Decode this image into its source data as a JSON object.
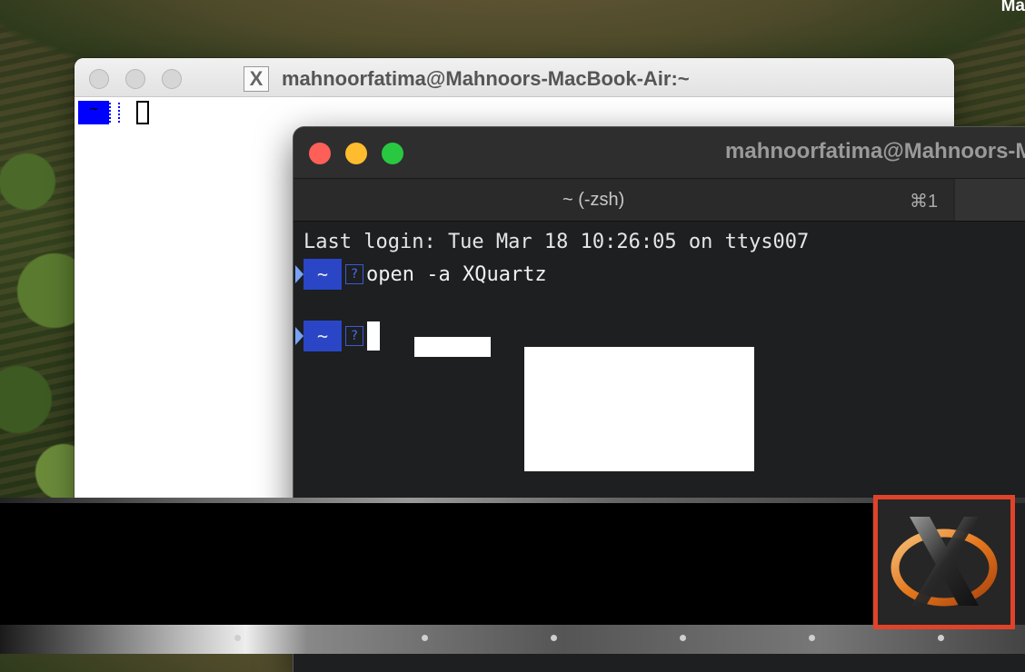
{
  "desktop": {
    "corner_text": "Ma"
  },
  "xterm_window": {
    "title": "mahnoorfatima@Mahnoors-MacBook-Air:~",
    "prompt_dir": "~"
  },
  "terminal_window": {
    "title": "mahnoorfatima@Mahnoors-MacBook-Air:~",
    "tab_label": "~ (-zsh)",
    "tab_shortcut": "⌘1",
    "last_login": "Last login: Tue Mar 18 10:26:05 on ttys007",
    "prompt_dir": "~",
    "prompt_badge": "?",
    "command": "open -a XQuartz"
  },
  "colors": {
    "terminal_bg": "#1d1f21",
    "prompt_bg": "#2a46c6",
    "highlight_border": "#e0432a",
    "xterm_prompt_bg": "#0000ff"
  },
  "dock": {
    "highlighted_app": "XQuartz",
    "icons": [
      "xquartz-icon"
    ]
  }
}
